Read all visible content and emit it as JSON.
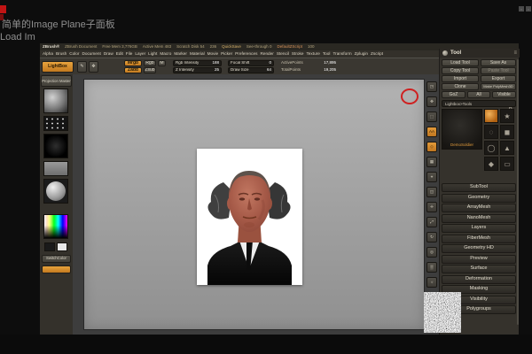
{
  "overlay": {
    "line1": "简单的Image Plane子面板",
    "line2": "Load Im"
  },
  "window": {
    "corner_icon_1": "▫",
    "corner_icon_2": "▫"
  },
  "colors": {
    "accent_orange": "#d08428",
    "canvas_gray": "#a6a6a6",
    "clay": "#a65a48"
  },
  "statusbar": {
    "logo": "ZBrush®",
    "items": [
      "ZBrush Document",
      "Free Mem 3,776GB",
      "Active Mem 483",
      "Scratch Disk 54",
      "236",
      "QuickSave",
      "See-through 0",
      "DefaultZScript",
      "100"
    ]
  },
  "menubar": {
    "items": [
      "Alpha",
      "Brush",
      "Color",
      "Document",
      "Draw",
      "Edit",
      "File",
      "Layer",
      "Light",
      "Macro",
      "Marker",
      "Material",
      "Movie",
      "Picker",
      "Preferences",
      "Render",
      "Stencil",
      "Stroke",
      "Texture",
      "Tool",
      "Transform",
      "Zplugin",
      "Zscript"
    ]
  },
  "toolbar": {
    "lightbox": "LightBox",
    "draw_icon": "✎",
    "gyro_icon": "✥",
    "mrgb": "Mrgb",
    "rgb": "Rgb",
    "m": "M",
    "zadd": "Zadd",
    "zsub": "Zsub",
    "rgb_intensity": {
      "label": "Rgb Intensity",
      "value": "188"
    },
    "z_intensity": {
      "label": "Z Intensity",
      "value": "25"
    },
    "focal_shift": {
      "label": "Focal Shift",
      "value": "0"
    },
    "draw_size": {
      "label": "Draw Size",
      "value": "64"
    },
    "active_points": {
      "label": "ActivePoints",
      "value": "17,895"
    },
    "total_points": {
      "label": "TotalPoints",
      "value": "19,205"
    }
  },
  "left_shelf": {
    "projection_master": "Projection Master",
    "switch_color": "SwitchColor"
  },
  "right_shelf": {
    "glyphs": [
      "◳",
      "✥",
      "⬚",
      "AA",
      "◇",
      "▦",
      "⌖",
      "◫",
      "✛",
      "⤢",
      "↻",
      "◎",
      "▒",
      "☼",
      "▣",
      "≡"
    ]
  },
  "tool_panel": {
    "title": "Tool",
    "menu_icon": "≡",
    "buttons": {
      "load": "Load Tool",
      "save_as": "Save As",
      "copy": "Copy Tool",
      "paste": "Paste Tool",
      "import": "Import",
      "export": "Export",
      "clone": "Clone",
      "make_polymesh": "Make PolyMesh3D",
      "goz": "GoZ",
      "all": "All",
      "visible": "Visible"
    },
    "lightbox_tools": "Lightbox>Tools",
    "active_tool": "DemoSoldier",
    "r_label": "R",
    "thumb_glyphs": [
      "★",
      "◌",
      "◼",
      "◯",
      "▲",
      "◆",
      "▭"
    ],
    "sections": [
      "SubTool",
      "Geometry",
      "ArrayMesh",
      "NanoMesh",
      "Layers",
      "FiberMesh",
      "Geometry HD",
      "Preview",
      "Surface",
      "Deformation",
      "Masking",
      "Visibility",
      "Polygroups"
    ]
  }
}
